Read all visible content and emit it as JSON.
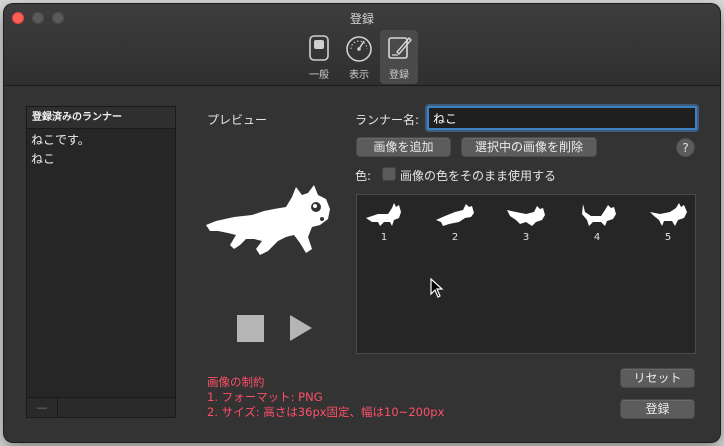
{
  "window": {
    "title": "登録"
  },
  "toolbar": {
    "items": [
      {
        "label": "一般",
        "icon": "switch-icon"
      },
      {
        "label": "表示",
        "icon": "gauge-icon"
      },
      {
        "label": "登録",
        "icon": "pen-icon"
      }
    ]
  },
  "runner_list": {
    "header": "登録済みのランナー",
    "items": [
      "ねこです。",
      "ねこ"
    ],
    "footer_button": "—"
  },
  "preview": {
    "label": "プレビュー"
  },
  "form": {
    "runner_name_label": "ランナー名:",
    "runner_name_value": "ねこ",
    "add_image_label": "画像を追加",
    "delete_selected_label": "選択中の画像を削除",
    "help_label": "?",
    "color_label": "色:",
    "use_image_color_label": "画像の色をそのまま使用する",
    "use_image_color_checked": false
  },
  "frames": [
    "1",
    "2",
    "3",
    "4",
    "5"
  ],
  "constraints": {
    "title": "画像の制約",
    "line1": "1. フォーマット: PNG",
    "line2": "2. サイズ: 高さは36px固定、幅は10~200px"
  },
  "actions": {
    "reset_label": "リセット",
    "register_label": "登録"
  },
  "colors": {
    "accent": "#3b82c4",
    "warning": "#ff4f68",
    "close": "#ff5f57"
  }
}
